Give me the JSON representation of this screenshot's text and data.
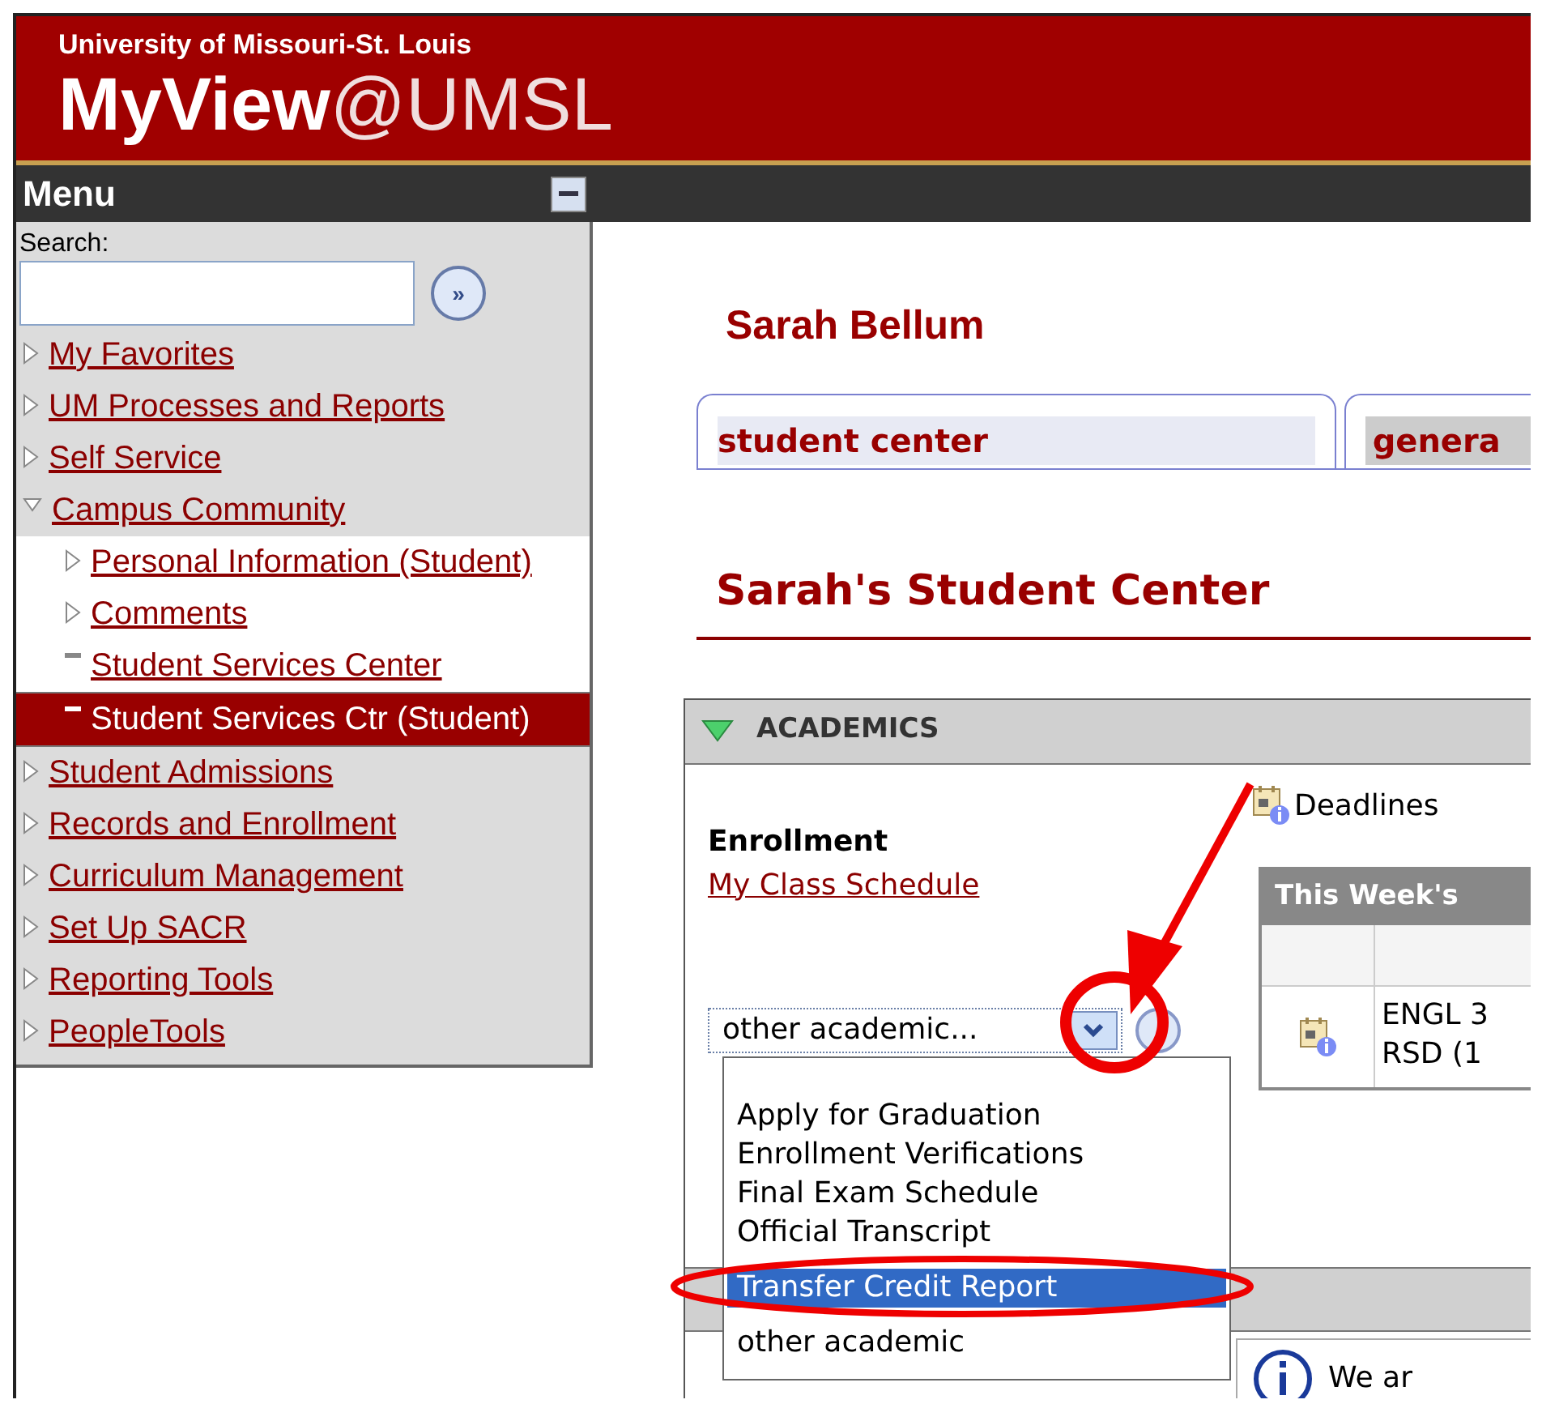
{
  "header": {
    "university": "University of Missouri-St. Louis",
    "brand_main": "MyView",
    "brand_suffix": "@UMSL"
  },
  "menu": {
    "title": "Menu",
    "search_label": "Search:",
    "go_symbol": "»",
    "items": [
      {
        "label": "My Favorites",
        "kind": "folder",
        "expanded": false,
        "selected": false
      },
      {
        "label": "UM Processes and Reports",
        "kind": "folder",
        "expanded": false,
        "selected": false
      },
      {
        "label": "Self Service",
        "kind": "folder",
        "expanded": false,
        "selected": false
      },
      {
        "label": "Campus Community",
        "kind": "folder",
        "expanded": true,
        "selected": false,
        "children": [
          {
            "label": "Personal Information (Student)",
            "kind": "folder",
            "expanded": false,
            "selected": false
          },
          {
            "label": "Comments",
            "kind": "folder",
            "expanded": false,
            "selected": false
          },
          {
            "label": "Student Services Center",
            "kind": "page",
            "selected": false
          },
          {
            "label": "Student Services Ctr (Student)",
            "kind": "page",
            "selected": true
          }
        ]
      },
      {
        "label": "Student Admissions",
        "kind": "folder",
        "expanded": false,
        "selected": false
      },
      {
        "label": "Records and Enrollment",
        "kind": "folder",
        "expanded": false,
        "selected": false
      },
      {
        "label": "Curriculum Management",
        "kind": "folder",
        "expanded": false,
        "selected": false
      },
      {
        "label": "Set Up SACR",
        "kind": "folder",
        "expanded": false,
        "selected": false
      },
      {
        "label": "Reporting Tools",
        "kind": "folder",
        "expanded": false,
        "selected": false
      },
      {
        "label": "PeopleTools",
        "kind": "folder",
        "expanded": false,
        "selected": false
      }
    ]
  },
  "content": {
    "person_name": "Sarah Bellum",
    "tabs": [
      {
        "label": "student center",
        "selected": true
      },
      {
        "label": "genera",
        "selected": false
      }
    ],
    "page_title": "Sarah's Student Center",
    "academics": {
      "title": "ACADEMICS",
      "expanded": true,
      "enrollment_heading": "Enrollment",
      "schedule_link": "My Class Schedule",
      "select": {
        "value": "other academic...",
        "options": [
          {
            "label": "Apply for Graduation",
            "selected": false
          },
          {
            "label": "Enrollment Verifications",
            "selected": false
          },
          {
            "label": "Final Exam Schedule",
            "selected": false
          },
          {
            "label": "Official Transcript",
            "selected": false
          },
          {
            "label": "Transfer Credit Report",
            "selected": true
          },
          {
            "label": "other academic",
            "selected": false
          }
        ]
      },
      "deadlines_link": "Deadlines",
      "week_table": {
        "title": "This Week's",
        "rows": [
          {
            "text": "ENGL 3",
            "subtext": "RSD (1"
          }
        ]
      }
    },
    "notice": "We ar"
  }
}
